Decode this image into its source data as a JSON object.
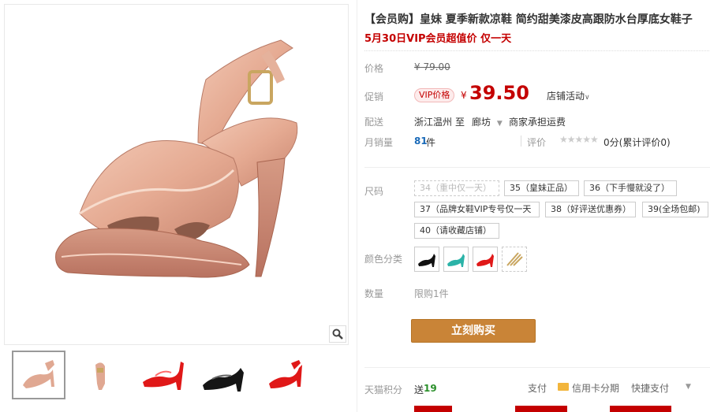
{
  "product": {
    "title": "【会员购】皇妹 夏季新款凉鞋 简约甜美漆皮高跟防水台厚底女鞋子",
    "promo_line": "5月30日VIP会员超值价 仅一天"
  },
  "price": {
    "label": "价格",
    "original": "¥ 79.00",
    "promo_label": "促销",
    "promo_tag": "VIP价格",
    "currency": "¥",
    "current": "39.50",
    "shop_activity": "店铺活动"
  },
  "shipping": {
    "label": "配送",
    "from": "浙江温州",
    "to_word": "至",
    "to": "廊坊",
    "fee": "商家承担运费"
  },
  "sales": {
    "label": "月销量",
    "count": "81",
    "unit": "件",
    "review_label": "评价",
    "stars": "★★★★★",
    "review_value": "0分(累计评价0)"
  },
  "size": {
    "label": "尺码",
    "options": [
      "34（重中仅一天）",
      "35（皇妹正品）",
      "36（下手慢就没了）",
      "37（品牌女鞋VIP专号仅一天",
      "38（好评送优惠券）",
      "39(全场包邮)",
      "40（请收藏店铺）"
    ]
  },
  "color": {
    "label": "颜色分类",
    "swatches": [
      "black",
      "teal",
      "red",
      "gold"
    ]
  },
  "quantity": {
    "label": "数量",
    "limit": "限购1件"
  },
  "buy_button": "立刻购买",
  "points": {
    "label": "天猫积分",
    "give": "送",
    "value": "19"
  },
  "payment": {
    "pay": "支付",
    "card": "信用卡分期",
    "quick": "快捷支付"
  },
  "colors": {
    "accent_red": "#c40000",
    "buy_button": "#c98437",
    "link_blue": "#1a6ab8"
  }
}
